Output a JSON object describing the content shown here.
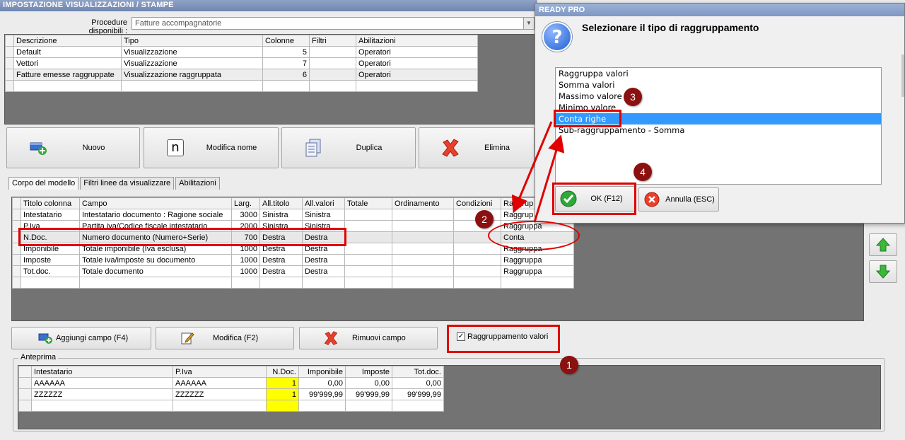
{
  "window": {
    "title": "IMPOSTAZIONE VISUALIZZAZIONI / STAMPE"
  },
  "procedures": {
    "label": "Procedure disponibili :",
    "selected": "Fatture accompagnatorie"
  },
  "models_table": {
    "headers": [
      "Descrizione",
      "Tipo",
      "Colonne",
      "Filtri",
      "Abilitazioni"
    ],
    "rows": [
      [
        "Default",
        "Visualizzazione",
        "5",
        "",
        "Operatori"
      ],
      [
        "Vettori",
        "Visualizzazione",
        "7",
        "",
        "Operatori"
      ],
      [
        "Fatture emesse raggruppate",
        "Visualizzazione raggruppata",
        "6",
        "",
        "Operatori"
      ]
    ]
  },
  "toolbar": {
    "new": "Nuovo",
    "rename": "Modifica nome",
    "duplicate": "Duplica",
    "delete": "Elimina",
    "rename_icon_glyph": "n"
  },
  "tabs": [
    "Corpo del modello",
    "Filtri linee da visualizzare",
    "Abilitazioni"
  ],
  "fields_table": {
    "headers": [
      "Titolo colonna",
      "Campo",
      "Larg.",
      "All.titolo",
      "All.valori",
      "Totale",
      "Ordinamento",
      "Condizioni",
      "Raggrup"
    ],
    "rows": [
      [
        "Intestatario",
        "Intestatario documento : Ragione sociale",
        "3000",
        "Sinistra",
        "Sinistra",
        "",
        "",
        "",
        "Raggrup"
      ],
      [
        "P.Iva",
        "Partita iva/Codice fiscale intestatario",
        "2000",
        "Sinistra",
        "Sinistra",
        "",
        "",
        "",
        "Raggruppa"
      ],
      [
        "N.Doc.",
        "Numero documento (Numero+Serie)",
        "700",
        "Destra",
        "Destra",
        "",
        "",
        "",
        "Conta"
      ],
      [
        "Imponibile",
        "Totale imponibile (Iva esclusa)",
        "1000",
        "Destra",
        "Destra",
        "",
        "",
        "",
        "Raggruppa"
      ],
      [
        "Imposte",
        "Totale iva/imposte su documento",
        "1000",
        "Destra",
        "Destra",
        "",
        "",
        "",
        "Raggruppa"
      ],
      [
        "Tot.doc.",
        "Totale documento",
        "1000",
        "Destra",
        "Destra",
        "",
        "",
        "",
        "Raggruppa"
      ]
    ]
  },
  "field_buttons": {
    "add": "Aggiungi campo (F4)",
    "edit": "Modifica (F2)",
    "remove": "Rimuovi campo",
    "group_checkbox": "Raggruppamento valori",
    "group_checked": true
  },
  "preview": {
    "label": "Anteprima",
    "headers": [
      "Intestatario",
      "P.Iva",
      "N.Doc.",
      "Imponibile",
      "Imposte",
      "Tot.doc."
    ],
    "rows": [
      [
        "AAAAAA",
        "AAAAAA",
        "1",
        "0,00",
        "0,00",
        "0,00"
      ],
      [
        "ZZZZZZ",
        "ZZZZZZ",
        "1",
        "99'999,99",
        "99'999,99",
        "99'999,99"
      ]
    ],
    "highlight_color": "#ffff00"
  },
  "dialog": {
    "title": "READY PRO",
    "question": "Selezionare il tipo di raggruppamento",
    "options": [
      "Raggruppa valori",
      "Somma valori",
      "Massimo valore",
      "Minimo valore",
      "Conta righe",
      "Sub-raggruppamento - Somma"
    ],
    "selected_index": 4,
    "ok": "OK (F12)",
    "cancel": "Annulla (ESC)"
  },
  "annotations": {
    "markers": [
      "1",
      "2",
      "3",
      "4"
    ],
    "color": "#e00000"
  }
}
